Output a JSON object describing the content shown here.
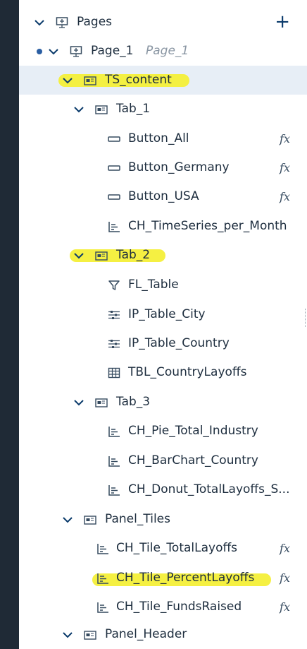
{
  "tree": {
    "pages": {
      "label": "Pages",
      "add": "+"
    },
    "page1": {
      "label": "Page_1",
      "sublabel": "Page_1"
    },
    "ts_content": {
      "label": "TS_content"
    },
    "tab1": {
      "label": "Tab_1"
    },
    "button_all": {
      "label": "Button_All",
      "fx": "fx"
    },
    "button_germany": {
      "label": "Button_Germany",
      "fx": "fx"
    },
    "button_usa": {
      "label": "Button_USA",
      "fx": "fx"
    },
    "ch_timeseries": {
      "label": "CH_TimeSeries_per_Month"
    },
    "tab2": {
      "label": "Tab_2"
    },
    "fl_table": {
      "label": "FL_Table"
    },
    "ip_table_city": {
      "label": "IP_Table_City"
    },
    "ip_table_country": {
      "label": "IP_Table_Country"
    },
    "tbl_country": {
      "label": "TBL_CountryLayoffs"
    },
    "tab3": {
      "label": "Tab_3"
    },
    "ch_pie": {
      "label": "CH_Pie_Total_Industry"
    },
    "ch_bar": {
      "label": "CH_BarChart_Country"
    },
    "ch_donut": {
      "label": "CH_Donut_TotalLayoffs_S..."
    },
    "panel_tiles": {
      "label": "Panel_Tiles"
    },
    "tile_total": {
      "label": "CH_Tile_TotalLayoffs",
      "fx": "fx"
    },
    "tile_percent": {
      "label": "CH_Tile_PercentLayoffs",
      "fx": "fx"
    },
    "tile_funds": {
      "label": "CH_Tile_FundsRaised",
      "fx": "fx"
    },
    "panel_header": {
      "label": "Panel_Header"
    }
  },
  "colors": {
    "strip": "#1f2a36",
    "selected_row": "#e7eef6",
    "highlighter": "#f4ef38",
    "accent_dot": "#2a5ea3"
  }
}
